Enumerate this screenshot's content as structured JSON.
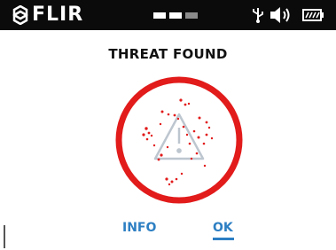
{
  "status_bar": {
    "brand": "FLIR",
    "icons": [
      "flir-shield-icon",
      "signal-dashes",
      "usb-icon",
      "speaker-icon",
      "battery-icon"
    ],
    "background_color": "#0b0b0b"
  },
  "dialog": {
    "title": "THREAT FOUND",
    "icon": "warning-triangle-icon",
    "accent_color": "#e21b1b"
  },
  "buttons": {
    "info_label": "INFO",
    "ok_label": "OK",
    "link_color": "#2d7fc3"
  }
}
